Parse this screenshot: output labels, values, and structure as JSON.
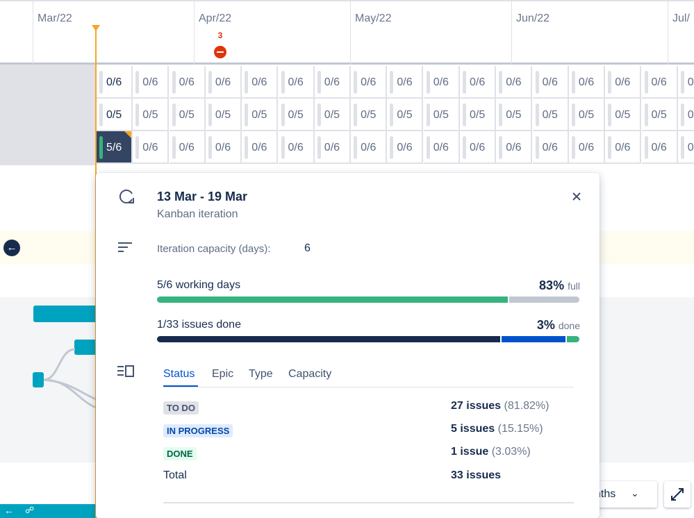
{
  "timeline": {
    "months": [
      "Mar/22",
      "Apr/22",
      "May/22",
      "Jun/22",
      "Jul/"
    ],
    "release_count": "3"
  },
  "capacity_grid": {
    "rows": [
      [
        "0/6",
        "0/6",
        "0/6",
        "0/6",
        "0/6",
        "0/6",
        "0/6",
        "0/6",
        "0/6",
        "0/6",
        "0/6",
        "0/6",
        "0/6",
        "0/6",
        "0/6",
        "0/6",
        "0"
      ],
      [
        "0/5",
        "0/5",
        "0/5",
        "0/5",
        "0/5",
        "0/5",
        "0/5",
        "0/5",
        "0/5",
        "0/5",
        "0/5",
        "0/5",
        "0/5",
        "0/5",
        "0/5",
        "0/5",
        "0"
      ],
      [
        "5/6",
        "0/6",
        "0/6",
        "0/6",
        "0/6",
        "0/6",
        "0/6",
        "0/6",
        "0/6",
        "0/6",
        "0/6",
        "0/6",
        "0/6",
        "0/6",
        "0/6",
        "0/6",
        "0"
      ]
    ]
  },
  "popup": {
    "title": "13 Mar - 19 Mar",
    "subtitle": "Kanban iteration",
    "capacity_label": "Iteration capacity (days):",
    "capacity_value": "6",
    "working_days": {
      "label": "5/6 working days",
      "percent": "83%",
      "suffix": "full",
      "fill": 0.833,
      "colors": {
        "filled": "#36b37e",
        "remaining": "#c1c7d0"
      }
    },
    "issues": {
      "label": "1/33 issues done",
      "percent": "3%",
      "suffix": "done",
      "segments": [
        0.8182,
        0.1515,
        0.0303
      ],
      "colors": [
        "#172b4d",
        "#0052cc",
        "#36b37e"
      ]
    },
    "tabs": [
      "Status",
      "Epic",
      "Type",
      "Capacity"
    ],
    "statuses": [
      {
        "label": "TO DO",
        "count": "27 issues",
        "pct": "(81.82%)"
      },
      {
        "label": "IN PROGRESS",
        "count": "5 issues",
        "pct": "(15.15%)"
      },
      {
        "label": "DONE",
        "count": "1 issue",
        "pct": "(3.03%)"
      }
    ],
    "total_label": "Total",
    "total_value": "33 issues"
  },
  "controls": {
    "zoom_label": "nths"
  },
  "icons": {
    "close": "close-icon",
    "iteration": "iteration-icon",
    "capacity": "sort-lines-icon",
    "breakdown": "panel-list-icon",
    "nav_back": "arrow-left-icon",
    "fullscreen": "expand-icon",
    "release": "release-warning-icon"
  }
}
